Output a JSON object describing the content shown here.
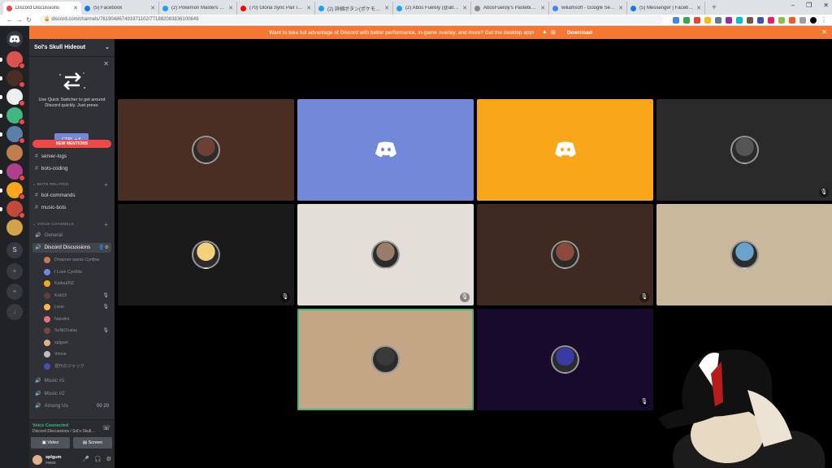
{
  "browser": {
    "tabs": [
      {
        "title": "Discord Discussions",
        "color": "#ed4245",
        "active": true
      },
      {
        "title": "(5) Facebook",
        "color": "#1877f2",
        "active": false
      },
      {
        "title": "(2) Pokémon Masters EX (@Poke…",
        "color": "#1da1f2",
        "active": false
      },
      {
        "title": "(70) Gloria Sync Pair Introductio…",
        "color": "#ff0000",
        "active": false
      },
      {
        "title": "(2) 詳細ボタン(ポケモンマスターズ公…",
        "color": "#1da1f2",
        "active": false
      },
      {
        "title": "(2) Abos Fuelsly (@abos_fuels…",
        "color": "#1da1f2",
        "active": false
      },
      {
        "title": "AbosFuelsly's Pastebin - Pastebin…",
        "color": "#888888",
        "active": false
      },
      {
        "title": "wiliamsoft - Google Search",
        "color": "#4285f4",
        "active": false
      },
      {
        "title": "(5) Messenger | Facebook",
        "color": "#1877f2",
        "active": false
      }
    ],
    "url": "discord.com/channels/761904867491971102/771882083836100649",
    "new_tab": "+",
    "window_controls": [
      "–",
      "❐",
      "✕"
    ]
  },
  "banner": {
    "text": "Want to take full advantage of Discord with better performance, in-game overlay, and more? Get the desktop app!",
    "download": "Download"
  },
  "server": {
    "name": "Sol's Skull Hideout"
  },
  "quick_switcher": {
    "text": "Use Quick Switcher to get around Discord quickly. Just press:",
    "shortcut": "CTRL + K"
  },
  "new_mentions": "NEW MENTIONS",
  "channels": {
    "text_top": [
      "server-logs",
      "bots-coding"
    ],
    "bots_category": "BOTS RELATED",
    "bots": [
      "bot-commands",
      "music-bots"
    ],
    "voice_category": "VOICE CHANNELS",
    "general": "General",
    "active_voice": "Discord Discussions",
    "voice_users": [
      {
        "name": "Dreamer wants Cynthia",
        "color": "#c27c4e",
        "mute": false
      },
      {
        "name": "I Love Cynthia",
        "color": "#7289da",
        "mute": false
      },
      {
        "name": "Kaitou00Z",
        "color": "#faa61a",
        "mute": false
      },
      {
        "name": "Kob15",
        "color": "#5d4037",
        "mute": true
      },
      {
        "name": "Leon",
        "color": "#ffb74d",
        "mute": true
      },
      {
        "name": "Nandini",
        "color": "#e57373",
        "mute": false
      },
      {
        "name": "SoNiChalas",
        "color": "#6d4c41",
        "mute": true
      },
      {
        "name": "splgum",
        "color": "#e3b08c",
        "mute": false
      },
      {
        "name": "Vinnie",
        "color": "#bdbdbd",
        "mute": false
      },
      {
        "name": "週刊のジャック",
        "color": "#3f51b5",
        "mute": false
      }
    ],
    "other_voice": [
      {
        "name": "Music #1",
        "count": ""
      },
      {
        "name": "Music #2",
        "count": ""
      },
      {
        "name": "Among Us",
        "count": "00 20"
      }
    ]
  },
  "voice_panel": {
    "status": "Voice Connected",
    "location": "Discord Discussions / Sol's Skull…",
    "video_label": "Video",
    "screen_label": "Screen"
  },
  "user_panel": {
    "name": "splgum",
    "tag": "#9909"
  },
  "tiles": [
    {
      "bg": "#4a2e24",
      "avatar": "#6d4033",
      "discord_logo": false,
      "mute": false,
      "speaking": false
    },
    {
      "bg": "#7289da",
      "avatar": "",
      "discord_logo": true,
      "mute": false,
      "speaking": false
    },
    {
      "bg": "#faa61a",
      "avatar": "",
      "discord_logo": true,
      "mute": false,
      "speaking": false
    },
    {
      "bg": "#2a2a2a",
      "avatar": "#555555",
      "discord_logo": false,
      "mute": true,
      "speaking": false
    },
    {
      "bg": "#1a1a1a",
      "avatar": "#f2d17a",
      "discord_logo": false,
      "mute": true,
      "speaking": false
    },
    {
      "bg": "#e3ded8",
      "avatar": "#9b7b6a",
      "discord_logo": false,
      "mute": true,
      "speaking": false
    },
    {
      "bg": "#3e2a20",
      "avatar": "#8b4a3a",
      "discord_logo": false,
      "mute": true,
      "speaking": false
    },
    {
      "bg": "#c9b89c",
      "avatar": "#6aa3c9",
      "discord_logo": false,
      "mute": false,
      "speaking": false
    },
    {
      "bg": "#c4a584",
      "avatar": "#3a3a3a",
      "discord_logo": false,
      "mute": false,
      "speaking": true
    },
    {
      "bg": "#170a2c",
      "avatar": "#3a3aa5",
      "discord_logo": false,
      "mute": true,
      "speaking": false
    }
  ],
  "rail": {
    "servers": [
      {
        "color": "#d9534f",
        "badge": true,
        "pill": true
      },
      {
        "color": "#4a2e24",
        "badge": true,
        "pill": true
      },
      {
        "color": "#eeeeee",
        "badge": true,
        "pill": true
      },
      {
        "color": "#43b581",
        "badge": true,
        "pill": true
      },
      {
        "color": "#5a7fa8",
        "badge": true,
        "pill": true
      },
      {
        "color": "#c27c4e",
        "badge": false,
        "pill": false
      },
      {
        "color": "#b0408c",
        "badge": true,
        "pill": true
      },
      {
        "color": "#faa61a",
        "badge": true,
        "pill": true
      },
      {
        "color": "#c34a3a",
        "badge": true,
        "pill": true
      },
      {
        "color": "#d4a24a",
        "badge": false,
        "pill": false
      }
    ],
    "letter": "S",
    "add": "+",
    "explore": "⌖",
    "download": "↓"
  }
}
